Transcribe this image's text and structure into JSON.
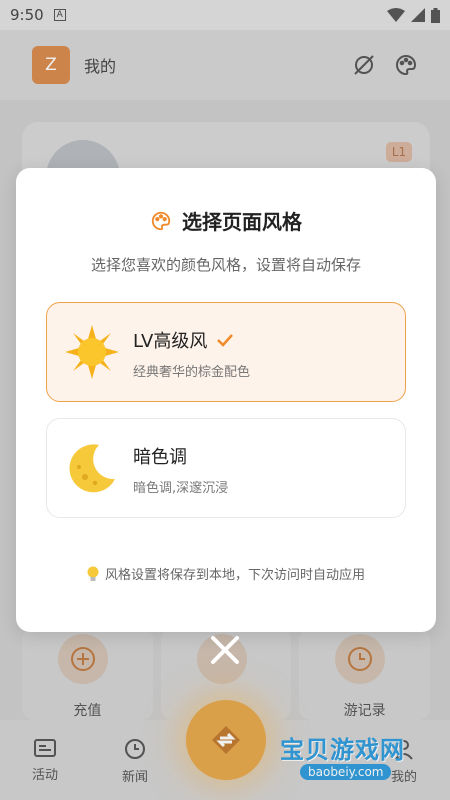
{
  "status_bar": {
    "time": "9:50",
    "notif_letter": "A"
  },
  "header": {
    "avatar_letter": "Z",
    "title": "我的"
  },
  "profile": {
    "level_badge": "L1"
  },
  "tiles": [
    {
      "label": "充值",
      "icon": "plus-circle-icon"
    },
    {
      "label": "",
      "icon": "close-circle-icon"
    },
    {
      "label": "游记录",
      "icon": "clock-icon"
    }
  ],
  "nav": {
    "items": [
      {
        "label": "活动",
        "icon": "news-icon"
      },
      {
        "label": "新闻",
        "icon": "clock-icon"
      },
      {
        "label": "我的",
        "icon": "user-icon"
      }
    ]
  },
  "dialog": {
    "title": "选择页面风格",
    "subtitle": "选择您喜欢的颜色风格，设置将自动保存",
    "options": [
      {
        "name": "LV高级风",
        "desc": "经典奢华的棕金配色",
        "icon": "sun-icon",
        "selected": true
      },
      {
        "name": "暗色调",
        "desc": "暗色调,深邃沉浸",
        "icon": "moon-icon",
        "selected": false
      }
    ],
    "tip": "风格设置将保存到本地，下次访问时自动应用"
  },
  "watermark": {
    "text": "宝贝游戏网",
    "url": "baobeiy.com"
  },
  "colors": {
    "accent": "#f08a2a",
    "selected_bg": "#fdf3ea",
    "avatar": "#d98a4c"
  }
}
